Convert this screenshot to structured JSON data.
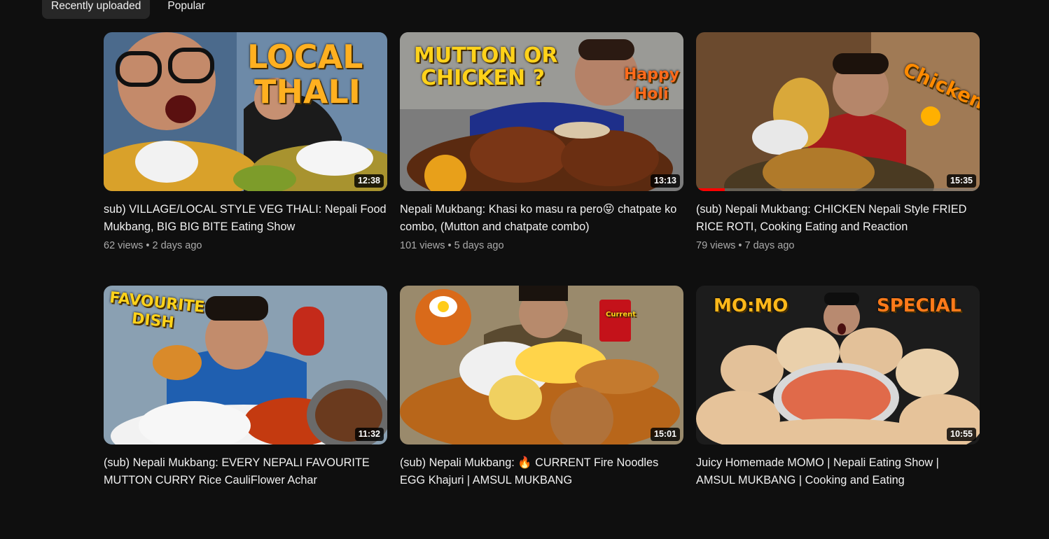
{
  "tabs": [
    {
      "label": "Recently uploaded",
      "active": true
    },
    {
      "label": "Popular",
      "active": false
    }
  ],
  "videos": [
    {
      "title": "sub) VILLAGE/LOCAL STYLE VEG THALI: Nepali Food Mukbang, BIG BIG BITE Eating Show",
      "views": "62 views",
      "age": "2 days ago",
      "duration": "12:38",
      "overlay": [
        "LOCAL",
        "THALI"
      ],
      "watched_fraction": 0
    },
    {
      "title": "Nepali Mukbang: Khasi ko masu ra pero😝 chatpate ko combo, (Mutton and chatpate combo)",
      "views": "101 views",
      "age": "5 days ago",
      "duration": "13:13",
      "overlay": [
        "MUTTON OR",
        "CHICKEN ?",
        "Happy",
        "Holi"
      ],
      "watched_fraction": 0
    },
    {
      "title": "(sub) Nepali Mukbang: CHICKEN Nepali Style FRIED RICE ROTI, Cooking Eating and Reaction",
      "views": "79 views",
      "age": "7 days ago",
      "duration": "15:35",
      "overlay": [
        "Chicken"
      ],
      "watched_fraction": 0.1
    },
    {
      "title": "(sub) Nepali Mukbang: EVERY NEPALI FAVOURITE MUTTON CURRY Rice CauliFlower Achar",
      "views": "",
      "age": "",
      "duration": "11:32",
      "overlay": [
        "FAVOURITE",
        "DISH"
      ],
      "watched_fraction": 0
    },
    {
      "title": "(sub) Nepali Mukbang: 🔥 CURRENT Fire Noodles EGG Khajuri | AMSUL MUKBANG",
      "views": "",
      "age": "",
      "duration": "15:01",
      "overlay": [
        "Current"
      ],
      "watched_fraction": 0
    },
    {
      "title": "Juicy Homemade MOMO | Nepali Eating Show | AMSUL MUKBANG | Cooking and Eating",
      "views": "",
      "age": "",
      "duration": "10:55",
      "overlay": [
        "MO:MO",
        "SPECIAL"
      ],
      "watched_fraction": 0
    }
  ],
  "colors": {
    "background": "#0f0f0f",
    "chip_active": "#272727",
    "text_primary": "#f1f1f1",
    "text_secondary": "#aaaaaa",
    "progress": "#ff0000"
  }
}
